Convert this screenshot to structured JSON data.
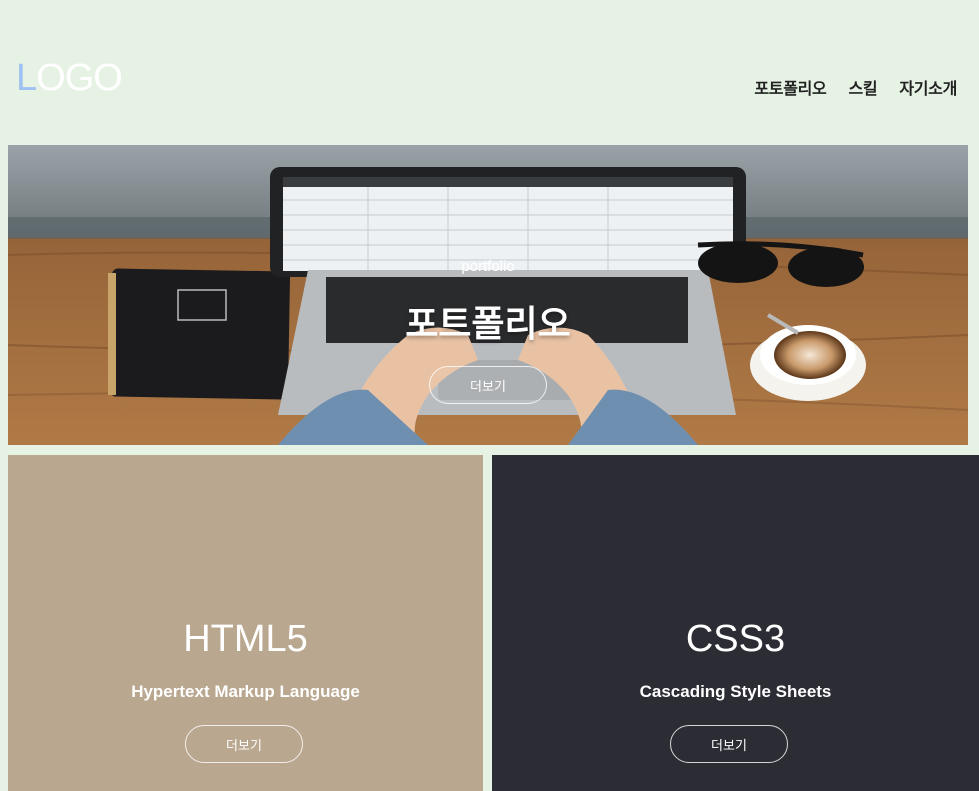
{
  "header": {
    "logo_first": "L",
    "logo_rest": "OGO",
    "nav": [
      "포토폴리오",
      "스킬",
      "자기소개"
    ]
  },
  "hero": {
    "subtitle": "portfolio",
    "title": "포트폴리오",
    "button": "더보기"
  },
  "cards": [
    {
      "title": "HTML5",
      "subtitle": "Hypertext Markup Language",
      "button": "더보기",
      "background": "#b9a78f"
    },
    {
      "title": "CSS3",
      "subtitle": "Cascading Style Sheets",
      "button": "더보기",
      "background": "#2c2d34"
    }
  ],
  "colors": {
    "page_background": "#e6f3e4",
    "logo_accent": "#9fc0f2"
  }
}
